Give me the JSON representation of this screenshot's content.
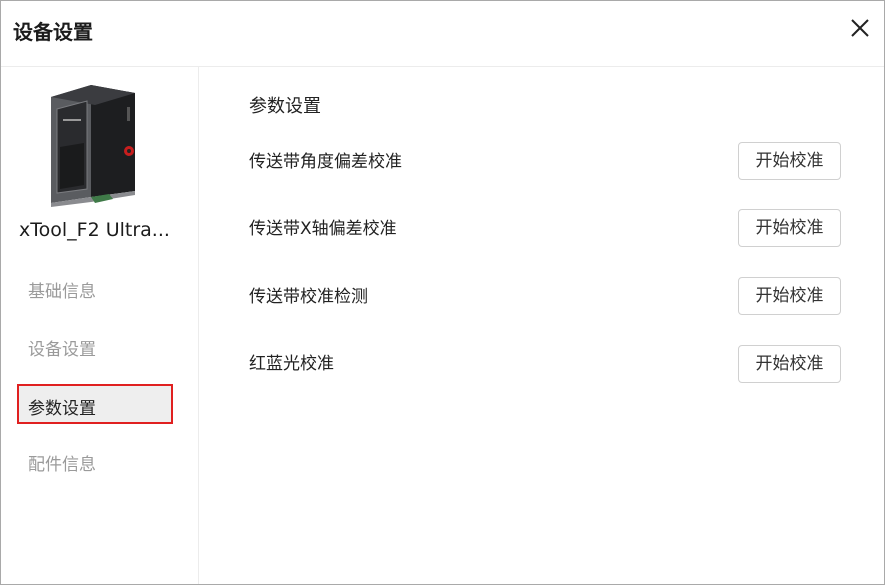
{
  "window": {
    "title": "设备设置"
  },
  "sidebar": {
    "device_name": "xTool_F2 Ultra...",
    "items": [
      {
        "label": "基础信息"
      },
      {
        "label": "设备设置"
      },
      {
        "label": "参数设置",
        "active": true
      },
      {
        "label": "配件信息"
      }
    ]
  },
  "main": {
    "section_title": "参数设置",
    "rows": [
      {
        "label": "传送带角度偏差校准",
        "button": "开始校准"
      },
      {
        "label": "传送带X轴偏差校准",
        "button": "开始校准"
      },
      {
        "label": "传送带校准检测",
        "button": "开始校准"
      },
      {
        "label": "红蓝光校准",
        "button": "开始校准"
      }
    ]
  },
  "colors": {
    "highlight_border": "#e02020",
    "active_bg": "#eeeeee",
    "inactive_text": "#9a9a9a"
  }
}
